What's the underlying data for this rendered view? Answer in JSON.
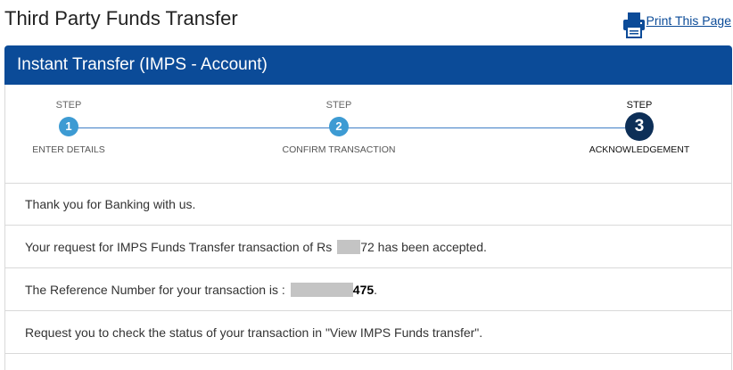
{
  "page": {
    "title": "Third Party Funds Transfer",
    "print_label": "Print This Page"
  },
  "panel": {
    "title": "Instant Transfer (IMPS - Account)"
  },
  "steps": [
    {
      "caption": "STEP",
      "number": "1",
      "name": "ENTER DETAILS",
      "state": "completed"
    },
    {
      "caption": "STEP",
      "number": "2",
      "name": "CONFIRM TRANSACTION",
      "state": "completed"
    },
    {
      "caption": "STEP",
      "number": "3",
      "name": "ACKNOWLEDGEMENT",
      "state": "active"
    }
  ],
  "messages": {
    "thanks": "Thank you for Banking with us.",
    "request_prefix": "Your request for IMPS Funds Transfer transaction of Rs",
    "amount_visible": "72",
    "request_suffix": " has been accepted.",
    "reference_prefix": "The Reference Number for your transaction is :",
    "reference_visible": "475",
    "reference_suffix": ".",
    "status_note": "Request you to check the status of your transaction in \"View IMPS Funds transfer\"."
  },
  "colors": {
    "header_blue": "#0b4b98",
    "step_done": "#3d9bd3",
    "step_active": "#0d2f57",
    "link": "#0b4b98"
  },
  "icons": {
    "print": "printer-icon"
  }
}
